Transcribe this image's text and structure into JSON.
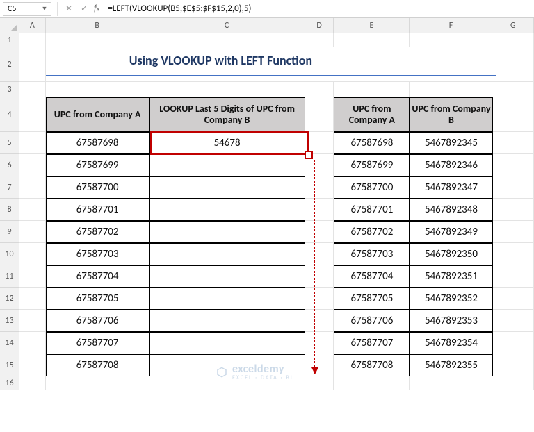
{
  "namebox": "C5",
  "formula": "=LEFT(VLOOKUP(B5,$E$5:$F$15,2,0),5)",
  "columns": [
    "A",
    "B",
    "C",
    "D",
    "E",
    "F",
    "G"
  ],
  "rows": [
    "1",
    "2",
    "3",
    "4",
    "5",
    "6",
    "7",
    "8",
    "9",
    "10",
    "11",
    "12",
    "13",
    "14",
    "15",
    "16"
  ],
  "title": "Using VLOOKUP with LEFT Function",
  "headers": {
    "B": "UPC from Company A",
    "C": "LOOKUP Last 5 Digits of UPC from Company B",
    "E": "UPC from Company A",
    "F": "UPC from Company B"
  },
  "left_table": {
    "B": [
      "67587698",
      "67587699",
      "67587700",
      "67587701",
      "67587702",
      "67587703",
      "67587704",
      "67587705",
      "67587706",
      "67587707",
      "67587708"
    ],
    "C": [
      "54678",
      "",
      "",
      "",
      "",
      "",
      "",
      "",
      "",
      "",
      ""
    ]
  },
  "right_table": {
    "E": [
      "67587698",
      "67587699",
      "67587700",
      "67587701",
      "67587702",
      "67587703",
      "67587704",
      "67587705",
      "67587706",
      "67587707",
      "67587708"
    ],
    "F": [
      "5467892345",
      "5467892346",
      "5467892347",
      "5467892348",
      "5467892349",
      "5467892350",
      "5467892351",
      "5467892352",
      "5467892353",
      "5467892354",
      "5467892355"
    ]
  },
  "watermark": {
    "brand": "exceldemy",
    "tag": "EXCEL · DATA · BI"
  },
  "chart_data": {
    "type": "table",
    "title": "Using VLOOKUP with LEFT Function",
    "tables": [
      {
        "range": "B4:C15",
        "columns": [
          "UPC from Company A",
          "LOOKUP Last 5 Digits of UPC from Company B"
        ],
        "rows": [
          [
            "67587698",
            "54678"
          ],
          [
            "67587699",
            ""
          ],
          [
            "67587700",
            ""
          ],
          [
            "67587701",
            ""
          ],
          [
            "67587702",
            ""
          ],
          [
            "67587703",
            ""
          ],
          [
            "67587704",
            ""
          ],
          [
            "67587705",
            ""
          ],
          [
            "67587706",
            ""
          ],
          [
            "67587707",
            ""
          ],
          [
            "67587708",
            ""
          ]
        ]
      },
      {
        "range": "E4:F15",
        "columns": [
          "UPC from Company A",
          "UPC from Company B"
        ],
        "rows": [
          [
            "67587698",
            "5467892345"
          ],
          [
            "67587699",
            "5467892346"
          ],
          [
            "67587700",
            "5467892347"
          ],
          [
            "67587701",
            "5467892348"
          ],
          [
            "67587702",
            "5467892349"
          ],
          [
            "67587703",
            "5467892350"
          ],
          [
            "67587704",
            "5467892351"
          ],
          [
            "67587705",
            "5467892352"
          ],
          [
            "67587706",
            "5467892353"
          ],
          [
            "67587707",
            "5467892354"
          ],
          [
            "67587708",
            "5467892355"
          ]
        ]
      }
    ]
  }
}
